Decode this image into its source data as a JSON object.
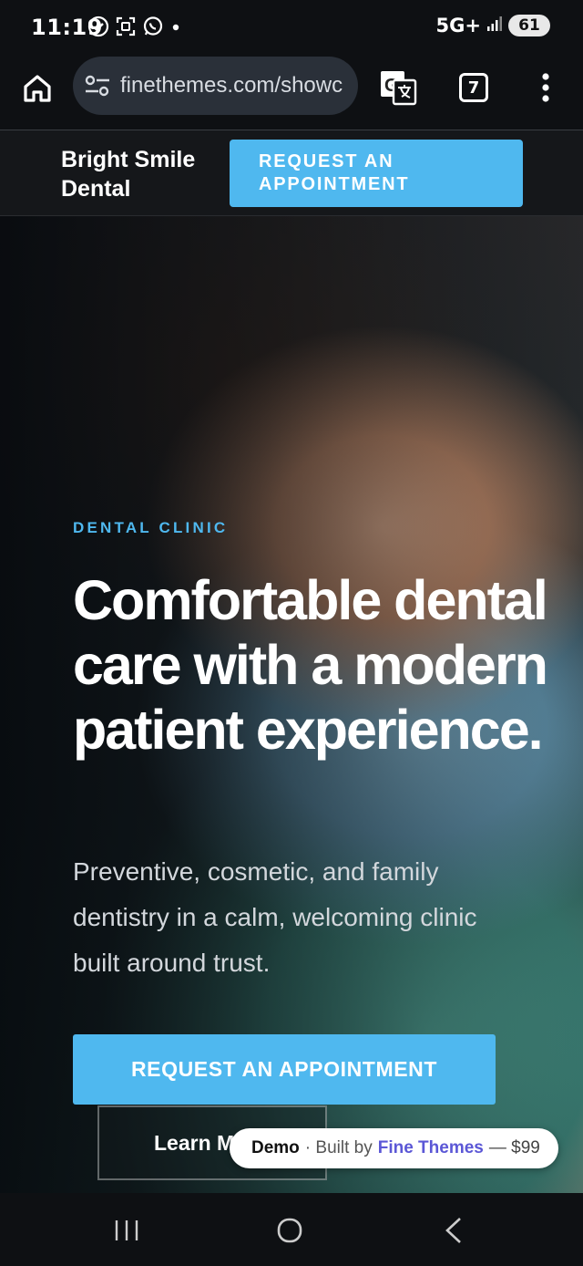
{
  "status_bar": {
    "time": "11:19",
    "network": "5G+",
    "battery": "61",
    "left_icons": [
      "check-circle-icon",
      "screenshot-icon",
      "whatsapp-icon",
      "dot-icon"
    ],
    "right_icons": [
      "signal-icon",
      "battery-icon"
    ]
  },
  "browser": {
    "url": "finethemes.com/showc",
    "tab_count": "7",
    "icons": [
      "home-icon",
      "site-settings-icon",
      "translate-icon",
      "tabs-icon",
      "more-vert-icon"
    ]
  },
  "site_header": {
    "brand": "Bright Smile Dental",
    "cta_label": "REQUEST AN APPOINTMENT"
  },
  "hero": {
    "eyebrow": "DENTAL CLINIC",
    "headline": "Comfortable dental care with a modern patient experience.",
    "subtext": "Preventive, cosmetic, and family dentistry in a calm, welcoming clinic built around trust.",
    "primary_cta": "REQUEST AN APPOINTMENT",
    "secondary_cta": "Learn M"
  },
  "demo_badge": {
    "label": "Demo",
    "built_by": "· Built by",
    "vendor": "Fine Themes",
    "price": "— $99"
  },
  "nav_bar": {
    "icons": [
      "recents-icon",
      "home-circle-icon",
      "back-icon"
    ]
  },
  "colors": {
    "accent": "#4fb8ef",
    "header_bg": "#15171a",
    "system_bg": "#0e1013",
    "demo_link": "#5b57d6"
  }
}
